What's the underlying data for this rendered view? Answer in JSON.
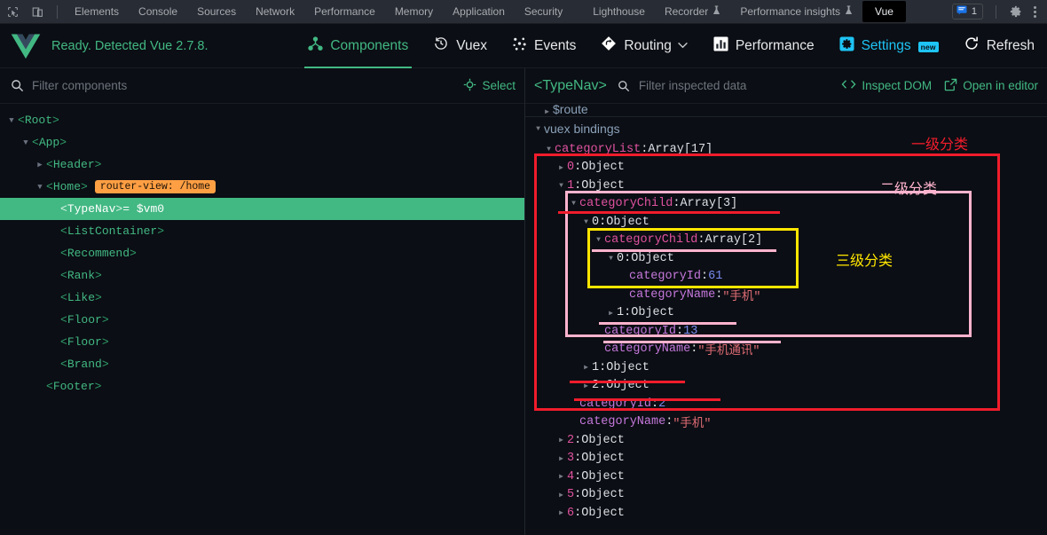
{
  "devtools_bar": {
    "icons": [
      "inspect-element-icon",
      "device-toolbar-icon"
    ],
    "tabs": [
      {
        "label": "Elements"
      },
      {
        "label": "Console"
      },
      {
        "label": "Sources"
      },
      {
        "label": "Network"
      },
      {
        "label": "Performance"
      },
      {
        "label": "Memory"
      },
      {
        "label": "Application"
      },
      {
        "label": "Security"
      },
      {
        "label": "Lighthouse"
      },
      {
        "label": "Recorder",
        "experiment": true
      },
      {
        "label": "Performance insights",
        "experiment": true
      },
      {
        "label": "Vue",
        "active": true
      }
    ],
    "message_count": "1",
    "settings_label": "gear-icon",
    "more_label": "kebab-menu-icon"
  },
  "vue_header": {
    "status": "Ready. Detected Vue 2.7.8.",
    "tabs": [
      {
        "label": "Components",
        "icon": "components-icon",
        "active": true
      },
      {
        "label": "Vuex",
        "icon": "history-icon",
        "active": false
      },
      {
        "label": "Events",
        "icon": "events-icon",
        "active": false
      },
      {
        "label": "Routing",
        "icon": "routing-icon",
        "active": false,
        "chevron": "⌄"
      },
      {
        "label": "Performance",
        "icon": "bar-chart-icon",
        "active": false
      },
      {
        "label": "Settings",
        "icon": "settings-gear-icon",
        "active": false,
        "badge": "new"
      },
      {
        "label": "Refresh",
        "icon": "refresh-icon",
        "active": false
      }
    ]
  },
  "left_pane": {
    "filter_placeholder": "Filter components",
    "select_label": "Select",
    "tree": [
      {
        "depth": 0,
        "arrow": "▼",
        "name": "Root",
        "selected": false,
        "vm": "",
        "chip": ""
      },
      {
        "depth": 1,
        "arrow": "▼",
        "name": "App",
        "selected": false,
        "vm": "",
        "chip": ""
      },
      {
        "depth": 2,
        "arrow": "▶",
        "name": "Header",
        "selected": false,
        "vm": "",
        "chip": ""
      },
      {
        "depth": 2,
        "arrow": "▼",
        "name": "Home",
        "selected": false,
        "vm": "",
        "chip": "router-view: /home"
      },
      {
        "depth": 3,
        "arrow": "",
        "name": "TypeNav",
        "selected": true,
        "vm": "= $vm0",
        "chip": ""
      },
      {
        "depth": 3,
        "arrow": "",
        "name": "ListContainer",
        "selected": false,
        "vm": "",
        "chip": ""
      },
      {
        "depth": 3,
        "arrow": "",
        "name": "Recommend",
        "selected": false,
        "vm": "",
        "chip": ""
      },
      {
        "depth": 3,
        "arrow": "",
        "name": "Rank",
        "selected": false,
        "vm": "",
        "chip": ""
      },
      {
        "depth": 3,
        "arrow": "",
        "name": "Like",
        "selected": false,
        "vm": "",
        "chip": ""
      },
      {
        "depth": 3,
        "arrow": "",
        "name": "Floor",
        "selected": false,
        "vm": "",
        "chip": ""
      },
      {
        "depth": 3,
        "arrow": "",
        "name": "Floor",
        "selected": false,
        "vm": "",
        "chip": ""
      },
      {
        "depth": 3,
        "arrow": "",
        "name": "Brand",
        "selected": false,
        "vm": "",
        "chip": ""
      },
      {
        "depth": 2,
        "arrow": "",
        "name": "Footer",
        "selected": false,
        "vm": "",
        "chip": ""
      }
    ]
  },
  "right_pane": {
    "component_name": "<TypeNav>",
    "filter_placeholder": "Filter inspected data",
    "inspect_dom_label": "Inspect DOM",
    "open_in_editor_label": "Open in editor",
    "clipped_row": "$route",
    "section_label": "vuex bindings",
    "rows": [
      {
        "indent": 0,
        "arrow": "▼",
        "key": "categoryList",
        "keyclass": "k-prop",
        "sep": ": ",
        "value": "Array[17]",
        "valclass": "v-type"
      },
      {
        "indent": 1,
        "arrow": "▶",
        "key": "0",
        "keyclass": "k-idx",
        "sep": ": ",
        "value": "Object",
        "valclass": "v-type"
      },
      {
        "indent": 1,
        "arrow": "▼",
        "key": "1",
        "keyclass": "k-idx",
        "sep": ": ",
        "value": "Object",
        "valclass": "v-type"
      },
      {
        "indent": 2,
        "arrow": "▼",
        "key": "categoryChild",
        "keyclass": "k-prop",
        "sep": ": ",
        "value": "Array[3]",
        "valclass": "v-type"
      },
      {
        "indent": 3,
        "arrow": "▼",
        "key": "0",
        "keyclass": "k-plain",
        "sep": ": ",
        "value": "Object",
        "valclass": "v-type"
      },
      {
        "indent": 4,
        "arrow": "▼",
        "key": "categoryChild",
        "keyclass": "k-prop",
        "sep": ": ",
        "value": "Array[2]",
        "valclass": "v-type"
      },
      {
        "indent": 5,
        "arrow": "▼",
        "key": "0",
        "keyclass": "k-plain",
        "sep": ": ",
        "value": "Object",
        "valclass": "v-type"
      },
      {
        "indent": 6,
        "arrow": "",
        "key": "categoryId",
        "keyclass": "k-prop2",
        "sep": ": ",
        "value": "61",
        "valclass": "v-num"
      },
      {
        "indent": 6,
        "arrow": "",
        "key": "categoryName",
        "keyclass": "k-prop2",
        "sep": ": ",
        "value": "\"手机\"",
        "valclass": "v-str"
      },
      {
        "indent": 5,
        "arrow": "▶",
        "key": "1",
        "keyclass": "k-plain",
        "sep": ": ",
        "value": "Object",
        "valclass": "v-type"
      },
      {
        "indent": 4,
        "arrow": "",
        "key": "categoryId",
        "keyclass": "k-prop2",
        "sep": ": ",
        "value": "13",
        "valclass": "v-num"
      },
      {
        "indent": 4,
        "arrow": "",
        "key": "categoryName",
        "keyclass": "k-prop2",
        "sep": ": ",
        "value": "\"手机通讯\"",
        "valclass": "v-str"
      },
      {
        "indent": 3,
        "arrow": "▶",
        "key": "1",
        "keyclass": "k-plain",
        "sep": ": ",
        "value": "Object",
        "valclass": "v-type"
      },
      {
        "indent": 3,
        "arrow": "▶",
        "key": "2",
        "keyclass": "k-plain",
        "sep": ": ",
        "value": "Object",
        "valclass": "v-type"
      },
      {
        "indent": 2,
        "arrow": "",
        "key": "categoryId",
        "keyclass": "k-prop2",
        "sep": ": ",
        "value": "2",
        "valclass": "v-num"
      },
      {
        "indent": 2,
        "arrow": "",
        "key": "categoryName",
        "keyclass": "k-prop2",
        "sep": ": ",
        "value": "\"手机\"",
        "valclass": "v-str"
      },
      {
        "indent": 1,
        "arrow": "▶",
        "key": "2",
        "keyclass": "k-idx",
        "sep": ": ",
        "value": "Object",
        "valclass": "v-type"
      },
      {
        "indent": 1,
        "arrow": "▶",
        "key": "3",
        "keyclass": "k-idx",
        "sep": ": ",
        "value": "Object",
        "valclass": "v-type"
      },
      {
        "indent": 1,
        "arrow": "▶",
        "key": "4",
        "keyclass": "k-idx",
        "sep": ": ",
        "value": "Object",
        "valclass": "v-type"
      },
      {
        "indent": 1,
        "arrow": "▶",
        "key": "5",
        "keyclass": "k-idx",
        "sep": ": ",
        "value": "Object",
        "valclass": "v-type"
      },
      {
        "indent": 1,
        "arrow": "▶",
        "key": "6",
        "keyclass": "k-idx",
        "sep": ": ",
        "value": "Object",
        "valclass": "v-type"
      }
    ]
  },
  "annotations": {
    "level1_label": "一级分类",
    "level2_label": "二级分类",
    "level3_label": "三级分类",
    "colors": {
      "level1": "#f01c2c",
      "level2": "#ffb3cd",
      "level3": "#ffe600"
    }
  }
}
